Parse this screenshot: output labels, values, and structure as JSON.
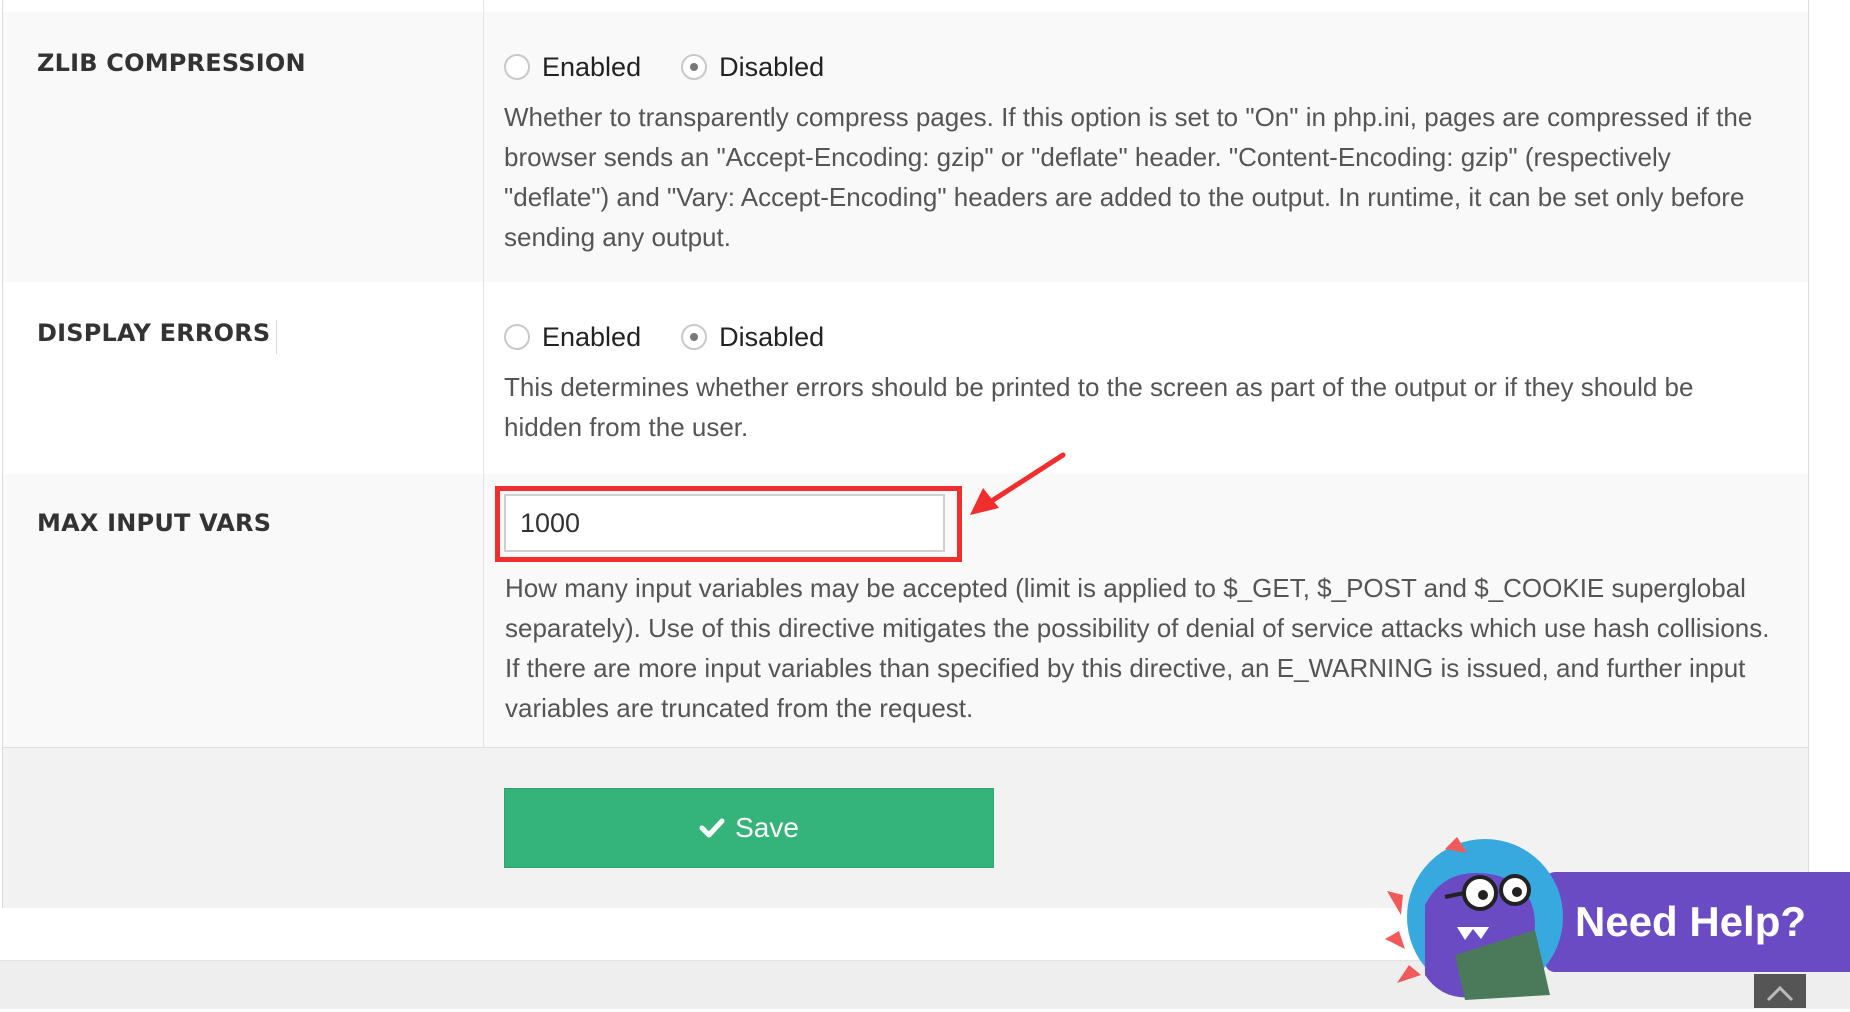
{
  "settings": {
    "zlib": {
      "label": "ZLIB COMPRESSION",
      "options": [
        "Enabled",
        "Disabled"
      ],
      "selected": "Disabled",
      "description": "Whether to transparently compress pages. If this option is set to \"On\" in php.ini, pages are compressed if the browser sends an \"Accept-Encoding: gzip\" or \"deflate\" header. \"Content-Encoding: gzip\" (respectively \"deflate\") and \"Vary: Accept-Encoding\" headers are added to the output. In runtime, it can be set only before sending any output."
    },
    "display_errors": {
      "label": "DISPLAY ERRORS",
      "options": [
        "Enabled",
        "Disabled"
      ],
      "selected": "Disabled",
      "description": "This determines whether errors should be printed to the screen as part of the output or if they should be hidden from the user."
    },
    "max_input_vars": {
      "label": "MAX INPUT VARS",
      "value": "1000",
      "description": "How many input variables may be accepted (limit is applied to $_GET, $_POST and $_COOKIE superglobal separately). Use of this directive mitigates the possibility of denial of service attacks which use hash collisions. If there are more input variables than specified by this directive, an E_WARNING is issued, and further input variables are truncated from the request."
    }
  },
  "actions": {
    "save_label": "Save"
  },
  "help": {
    "label": "Need Help?"
  },
  "colors": {
    "save_green": "#34b37a",
    "highlight_red": "#f02e2e",
    "help_purple": "#6a4bc4"
  }
}
